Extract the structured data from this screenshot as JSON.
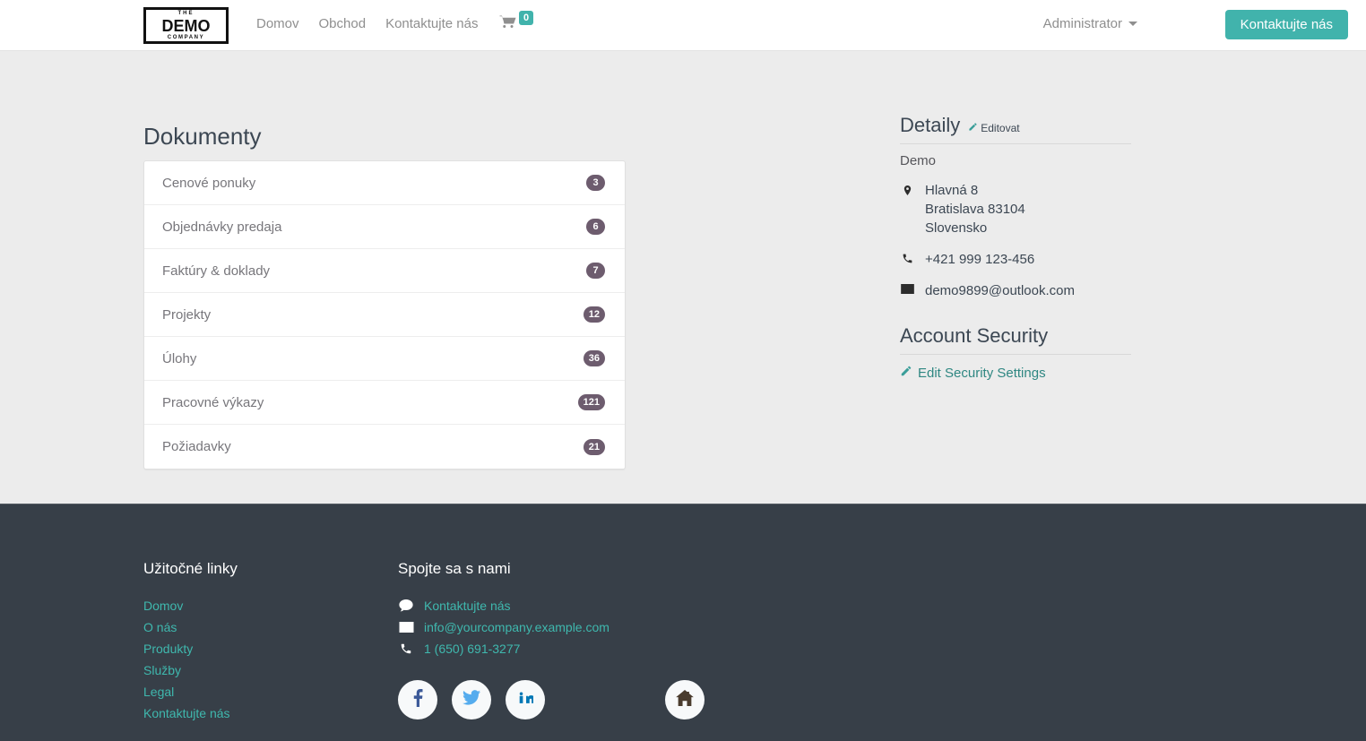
{
  "navbar": {
    "logo": {
      "top": "THE",
      "main": "DEMO",
      "bottom": "COMPANY"
    },
    "links": [
      {
        "label": "Domov"
      },
      {
        "label": "Obchod"
      },
      {
        "label": "Kontaktujte nás"
      }
    ],
    "cart": {
      "icon": "cart-icon",
      "count": "0"
    },
    "user": {
      "label": "Administrator"
    },
    "cta": {
      "label": "Kontaktujte nás"
    },
    "accent_color": "#41b3ac"
  },
  "main": {
    "title": "Dokumenty",
    "documents": [
      {
        "label": "Cenové ponuky",
        "count": "3"
      },
      {
        "label": "Objednávky predaja",
        "count": "6"
      },
      {
        "label": "Faktúry & doklady",
        "count": "7"
      },
      {
        "label": "Projekty",
        "count": "12"
      },
      {
        "label": "Úlohy",
        "count": "36"
      },
      {
        "label": "Pracovné výkazy",
        "count": "121"
      },
      {
        "label": "Požiadavky",
        "count": "21"
      }
    ],
    "badge_color": "#6d5c6e"
  },
  "sidebar": {
    "details_title": "Detaily",
    "edit_label": "Editovat",
    "org_name": "Demo",
    "address": "Hlavná 8\nBratislava 83104\nSlovensko",
    "address_line1": "Hlavná 8",
    "address_line2": "Bratislava 83104",
    "address_line3": "Slovensko",
    "phone": "+421 999 123-456",
    "email": "demo9899@outlook.com",
    "security_title": "Account Security",
    "security_link": "Edit Security Settings"
  },
  "footer": {
    "links_heading": "Užitočné linky",
    "links": [
      {
        "label": "Domov"
      },
      {
        "label": "O nás"
      },
      {
        "label": "Produkty"
      },
      {
        "label": "Služby"
      },
      {
        "label": "Legal"
      },
      {
        "label": "Kontaktujte nás"
      }
    ],
    "connect_heading": "Spojte sa s nami",
    "contacts": [
      {
        "icon": "chat-icon",
        "label": "Kontaktujte nás"
      },
      {
        "icon": "envelope-icon",
        "label": "info@yourcompany.example.com"
      },
      {
        "icon": "phone-icon",
        "label": "1 (650) 691-3277"
      }
    ],
    "socials": [
      {
        "icon": "facebook-icon"
      },
      {
        "icon": "twitter-icon"
      },
      {
        "icon": "linkedin-icon"
      }
    ],
    "home": {
      "icon": "home-icon"
    },
    "link_color": "#3fb8ae",
    "background": "#373f48"
  }
}
